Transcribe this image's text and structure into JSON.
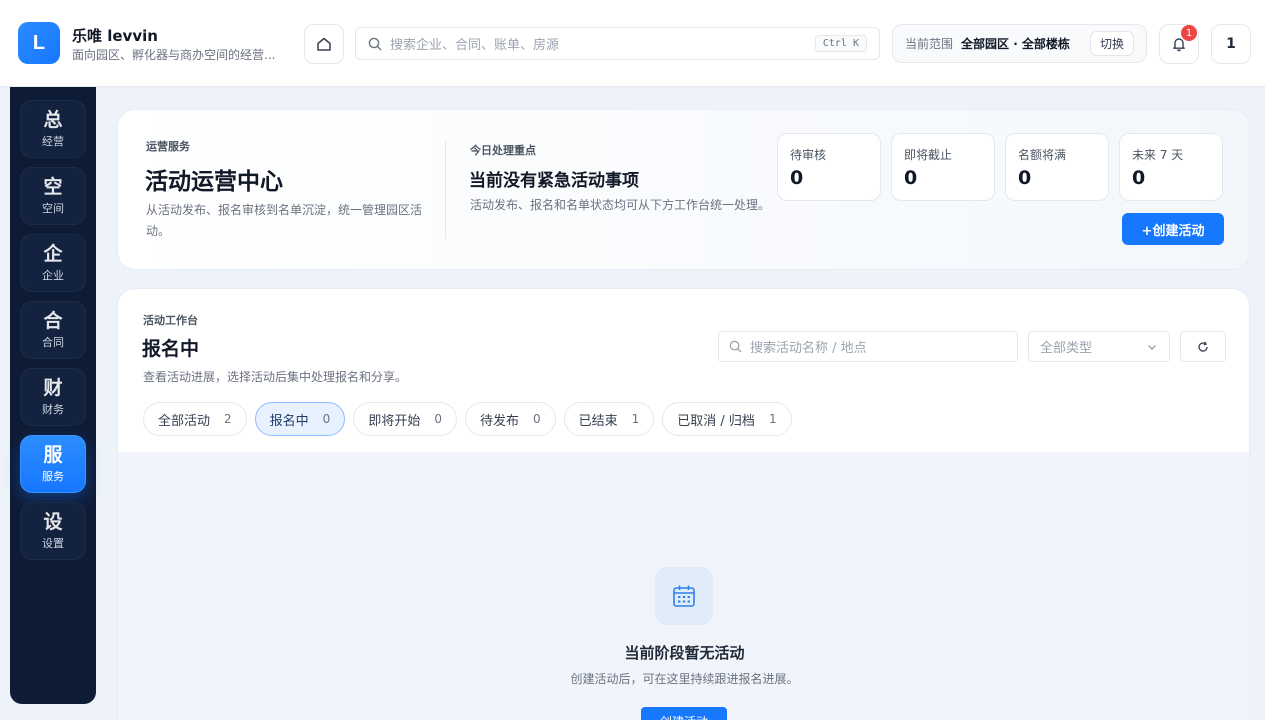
{
  "brand": {
    "logo_letter": "L",
    "name": "乐唯 levvin",
    "subtitle": "面向园区、孵化器与商办空间的经营..."
  },
  "search": {
    "placeholder": "搜索企业、合同、账单、房源",
    "shortcut": "Ctrl K"
  },
  "scope": {
    "label": "当前范围",
    "value": "全部园区 · 全部楼栋",
    "switch_label": "切换"
  },
  "notifications": {
    "count": "1"
  },
  "user": {
    "label": "1"
  },
  "sidebar": {
    "items": [
      {
        "char": "总",
        "label": "经营"
      },
      {
        "char": "空",
        "label": "空间"
      },
      {
        "char": "企",
        "label": "企业"
      },
      {
        "char": "合",
        "label": "合同"
      },
      {
        "char": "财",
        "label": "财务"
      },
      {
        "char": "服",
        "label": "服务"
      },
      {
        "char": "设",
        "label": "设置"
      }
    ]
  },
  "hero": {
    "kicker": "运营服务",
    "title": "活动运营中心",
    "desc": "从活动发布、报名审核到名单沉淀，统一管理园区活动。",
    "focus_kicker": "今日处理重点",
    "focus_title": "当前没有紧急活动事项",
    "focus_desc": "活动发布、报名和名单状态均可从下方工作台统一处理。",
    "stats": [
      {
        "label": "待审核",
        "value": "0"
      },
      {
        "label": "即将截止",
        "value": "0"
      },
      {
        "label": "名额将满",
        "value": "0"
      },
      {
        "label": "未来 7 天",
        "value": "0"
      }
    ],
    "create_label": "+创建活动"
  },
  "workbench": {
    "kicker": "活动工作台",
    "title": "报名中",
    "desc": "查看活动进展，选择活动后集中处理报名和分享。",
    "search_placeholder": "搜索活动名称 / 地点",
    "type_select": "全部类型",
    "tabs": [
      {
        "label": "全部活动",
        "count": "2"
      },
      {
        "label": "报名中",
        "count": "0"
      },
      {
        "label": "即将开始",
        "count": "0"
      },
      {
        "label": "待发布",
        "count": "0"
      },
      {
        "label": "已结束",
        "count": "1"
      },
      {
        "label": "已取消 / 归档",
        "count": "1"
      }
    ],
    "empty_title": "当前阶段暂无活动",
    "empty_desc": "创建活动后，可在这里持续跟进报名进展。",
    "empty_button": "创建活动"
  },
  "colors": {
    "accent": "#1677ff",
    "sidebar": "#0e1b34",
    "badge": "#ef4444"
  }
}
